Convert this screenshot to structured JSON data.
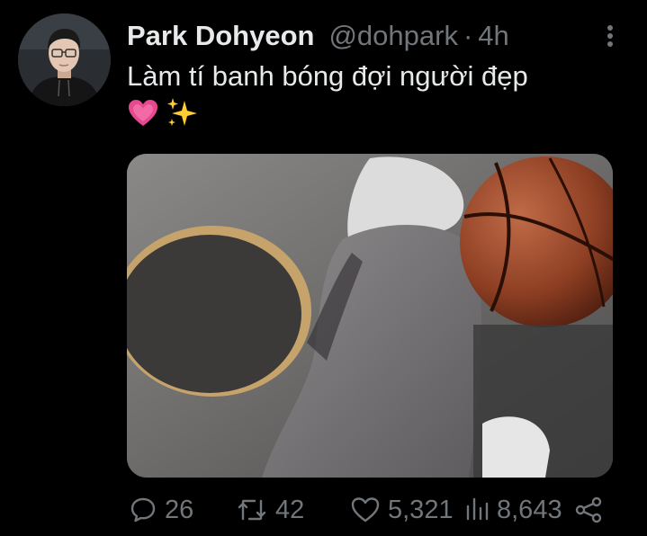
{
  "tweet": {
    "display_name": "Park Dohyeon",
    "handle": "@dohpark",
    "separator": "·",
    "time": "4h",
    "text": "Làm tí banh bóng đợi người đẹp",
    "emojis": [
      "pink-heart-icon",
      "sparkles-icon"
    ],
    "media_description_icon": "photo-icon"
  },
  "actions": {
    "replies": "26",
    "retweets": "42",
    "likes": "5,321",
    "views": "8,643"
  },
  "icons": {
    "more": "more-vertical-icon",
    "reply": "reply-icon",
    "retweet": "retweet-icon",
    "like": "heart-icon",
    "views": "views-icon",
    "share": "share-icon"
  },
  "colors": {
    "background": "#000000",
    "primary_text": "#e7e9ea",
    "secondary_text": "#71767b"
  }
}
